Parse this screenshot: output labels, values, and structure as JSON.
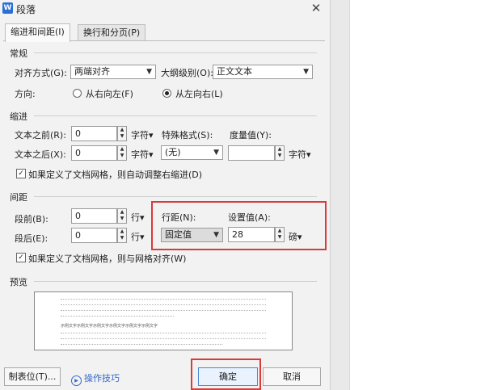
{
  "window": {
    "title": "段落",
    "app_icon": "W"
  },
  "tabs": [
    {
      "label": "缩进和间距(I)",
      "active": true
    },
    {
      "label": "换行和分页(P)",
      "active": false
    }
  ],
  "general": {
    "section": "常规",
    "alignment_label": "对齐方式(G):",
    "alignment_value": "两端对齐",
    "outline_label": "大纲级别(O):",
    "outline_value": "正文文本",
    "direction_label": "方向:",
    "direction_rtl": "从右向左(F)",
    "direction_ltr": "从左向右(L)"
  },
  "indent": {
    "section": "缩进",
    "before_label": "文本之前(R):",
    "before_value": "0",
    "before_unit": "字符",
    "after_label": "文本之后(X):",
    "after_value": "0",
    "after_unit": "字符",
    "special_label": "特殊格式(S):",
    "special_value": "(无)",
    "measure_label": "度量值(Y):",
    "measure_value": "",
    "measure_unit": "字符",
    "grid_check": "如果定义了文档网格，则自动调整右缩进(D)"
  },
  "spacing": {
    "section": "间距",
    "before_label": "段前(B):",
    "before_value": "0",
    "before_unit": "行",
    "after_label": "段后(E):",
    "after_value": "0",
    "after_unit": "行",
    "line_label": "行距(N):",
    "line_value": "固定值",
    "setting_label": "设置值(A):",
    "setting_value": "28",
    "setting_unit": "磅",
    "grid_check": "如果定义了文档网格，则与网格对齐(W)"
  },
  "preview": {
    "section": "预览",
    "sample_text": "示例文字示例文字示例文字示例文字示例文字示例文字"
  },
  "footer": {
    "tabs_button": "制表位(T)...",
    "tips": "操作技巧",
    "ok": "确定",
    "cancel": "取消"
  },
  "colors": {
    "highlight": "#d93a3a",
    "link": "#3568c8",
    "app_icon": "#2b6fd6"
  }
}
